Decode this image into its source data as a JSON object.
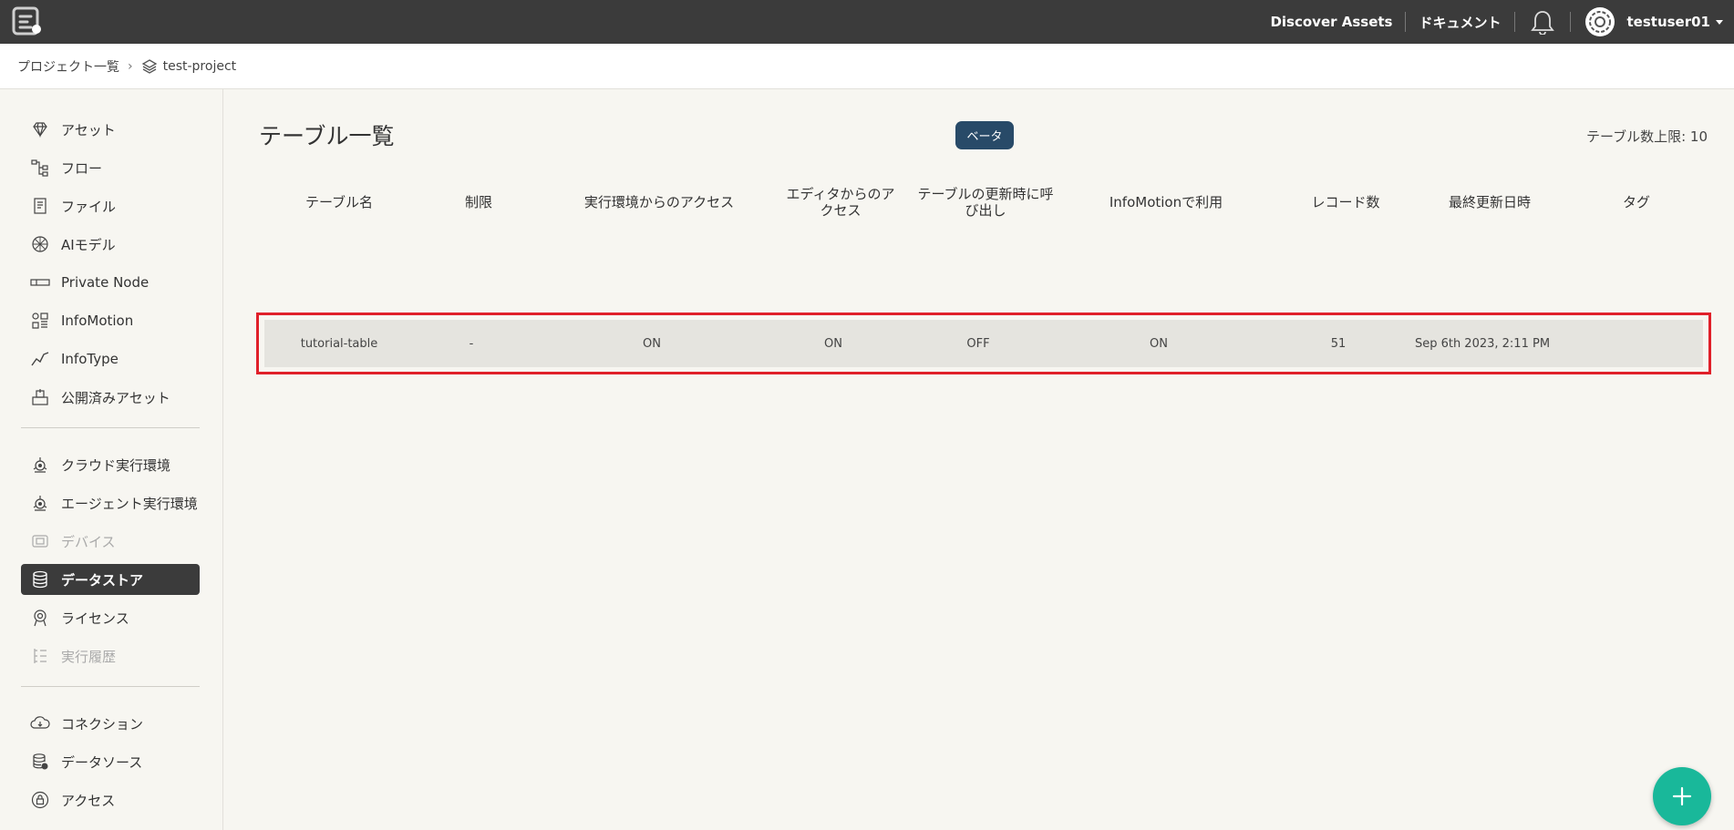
{
  "topbar": {
    "discover_assets": "Discover Assets",
    "documents": "ドキュメント",
    "username": "testuser01"
  },
  "breadcrumb": {
    "project_list": "プロジェクト一覧",
    "separator": "›",
    "current_project": "test-project"
  },
  "sidebar": {
    "items": [
      {
        "label": "アセット",
        "icon": "diamond-icon",
        "state": "normal"
      },
      {
        "label": "フロー",
        "icon": "flow-icon",
        "state": "normal"
      },
      {
        "label": "ファイル",
        "icon": "file-icon",
        "state": "normal"
      },
      {
        "label": "AIモデル",
        "icon": "ai-model-icon",
        "state": "normal"
      },
      {
        "label": "Private Node",
        "icon": "private-node-icon",
        "state": "normal"
      },
      {
        "label": "InfoMotion",
        "icon": "infomotion-icon",
        "state": "normal"
      },
      {
        "label": "InfoType",
        "icon": "infotype-icon",
        "state": "normal"
      },
      {
        "label": "公開済みアセット",
        "icon": "published-asset-icon",
        "state": "normal"
      },
      {
        "label": "クラウド実行環境",
        "icon": "cloud-runtime-icon",
        "state": "normal"
      },
      {
        "label": "エージェント実行環境",
        "icon": "agent-runtime-icon",
        "state": "normal"
      },
      {
        "label": "デバイス",
        "icon": "device-icon",
        "state": "disabled"
      },
      {
        "label": "データストア",
        "icon": "database-icon",
        "state": "active"
      },
      {
        "label": "ライセンス",
        "icon": "license-icon",
        "state": "normal"
      },
      {
        "label": "実行履歴",
        "icon": "history-icon",
        "state": "disabled"
      },
      {
        "label": "コネクション",
        "icon": "connection-icon",
        "state": "normal"
      },
      {
        "label": "データソース",
        "icon": "datasource-icon",
        "state": "normal"
      },
      {
        "label": "アクセス",
        "icon": "access-lock-icon",
        "state": "normal"
      }
    ]
  },
  "main": {
    "title": "テーブル一覧",
    "beta_badge": "ベータ",
    "table_limit": "テーブル数上限: 10",
    "columns": [
      "テーブル名",
      "制限",
      "実行環境からのアクセス",
      "エディタからのアクセス",
      "テーブルの更新時に呼び出し",
      "InfoMotionで利用",
      "レコード数",
      "最終更新日時",
      "タグ"
    ],
    "rows": [
      [
        "tutorial-table",
        "-",
        "ON",
        "ON",
        "OFF",
        "ON",
        "51",
        "Sep 6th 2023, 2:11 PM",
        ""
      ]
    ]
  },
  "fab": {
    "label": "+"
  },
  "colors": {
    "topbar": "#3b3b3b",
    "badge": "#284a68",
    "fab": "#19b89a",
    "highlight": "#e0202a"
  }
}
